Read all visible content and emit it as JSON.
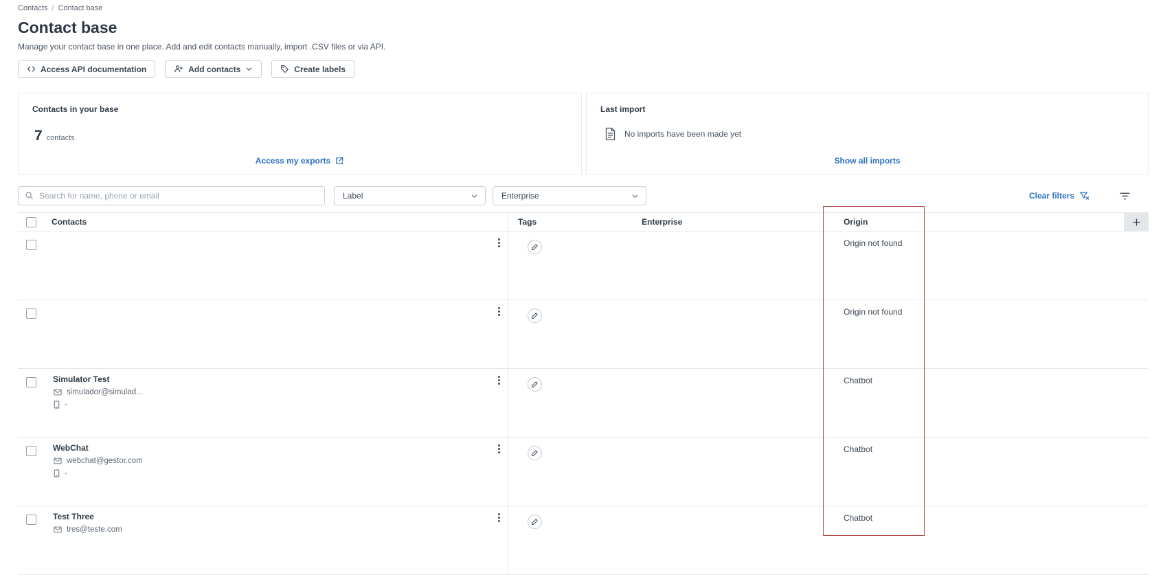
{
  "breadcrumb": {
    "contacts": "Contacts",
    "separator": "/",
    "current": "Contact base"
  },
  "header": {
    "title": "Contact base",
    "subtitle": "Manage your contact base in one place. Add and edit contacts manually, import .CSV files or via API."
  },
  "toolbar": {
    "access_api": "Access API documentation",
    "add_contacts": "Add contacts",
    "create_labels": "Create labels"
  },
  "summary_cards": {
    "contacts_card": {
      "title": "Contacts in your base",
      "count": "7",
      "unit": "contacts",
      "link": "Access my exports"
    },
    "import_card": {
      "title": "Last import",
      "empty_text": "No imports have been made yet",
      "link": "Show all imports"
    }
  },
  "filters": {
    "search_placeholder": "Search for name, phone or email",
    "label_dropdown": "Label",
    "enterprise_dropdown": "Enterprise",
    "clear_filters": "Clear filters"
  },
  "table": {
    "columns": {
      "contacts": "Contacts",
      "tags": "Tags",
      "enterprise": "Enterprise",
      "origin": "Origin"
    },
    "rows": [
      {
        "name": "",
        "email": "",
        "phone": "",
        "origin": "Origin not found"
      },
      {
        "name": "",
        "email": "",
        "phone": "",
        "origin": "Origin not found"
      },
      {
        "name": "Simulator Test",
        "email": "simulador@simulad...",
        "phone": "-",
        "origin": "Chatbot"
      },
      {
        "name": "WebChat",
        "email": "webchat@gestor.com",
        "phone": "-",
        "origin": "Chatbot"
      },
      {
        "name": "Test Three",
        "email": "tres@teste.com",
        "phone": "",
        "origin": "Chatbot"
      }
    ]
  },
  "icons": {
    "api": "code-brackets",
    "add_contact": "person-plus",
    "chevron_down": "chevron",
    "create_label": "tag",
    "document": "paper-sheet",
    "export": "box-arrow-out",
    "search": "magnifier",
    "clear_filter": "funnel-x",
    "filter": "filter-lines",
    "row_menu": "kebab-dots",
    "edit": "pencil",
    "email": "envelope",
    "phone": "mobile",
    "add_column": "plus"
  },
  "colors": {
    "link_blue": "#2b72c2",
    "annotation_red": "#b94a45",
    "border_gray": "#e4e7ea"
  }
}
